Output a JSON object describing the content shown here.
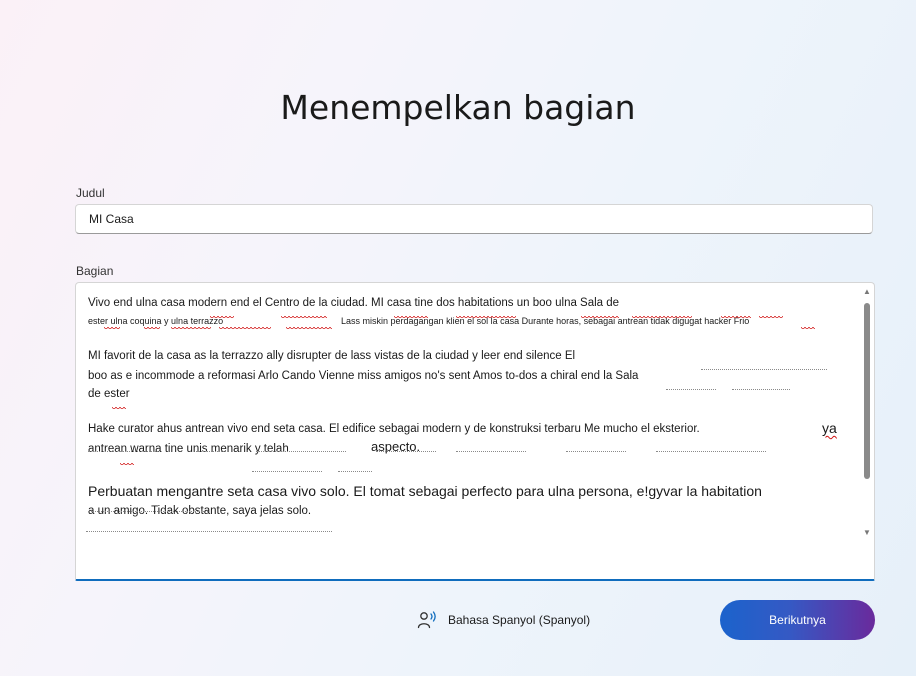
{
  "page": {
    "title": "Menempelkan bagian"
  },
  "form": {
    "title_label": "Judul",
    "title_value": "MI Casa",
    "passage_label": "Bagian",
    "passage": {
      "lines": [
        "Vivo end ulna casa modern end el Centro de la ciudad. MI casa tine dos habitations un boo ulna Sala de",
        "ester ulna coquina y ulna terrazzo",
        "Lass miskin perdagangan klien el sol la casa Durante horas, sebagai antrean tidak digugat hacker Frio",
        "MI favorit de la casa as la terrazzo ally disrupter de lass vistas de la ciudad y leer end silence El",
        "boo as e incommode a reformasi Arlo Cando Vienne miss amigos no's sent Amos to-dos a chiral end la Sala",
        "de ester",
        "Hake curator ahus antrean vivo end seta casa. El edifice sebagai modern y de konstruksi terbaru Me mucho el eksterior.",
        "ya",
        "antrean warna tine unis menarik y telah",
        "aspecto.",
        "Perbuatan mengantre seta casa vivo solo. El tomat sebagai perfecto para ulna persona, e!gyvar la habitation",
        "a un amigo. Tidak obstante, saya jelas solo."
      ]
    }
  },
  "footer": {
    "language_label": "Bahasa Spanyol (Spanyol)",
    "language_icon": "speaker-voice-icon",
    "next_label": "Berikutnya"
  },
  "colors": {
    "accent": "#0f6cbd",
    "button_gradient_start": "#1b63cc",
    "button_gradient_end": "#6a2a9c",
    "spellcheck": "#d01010"
  }
}
